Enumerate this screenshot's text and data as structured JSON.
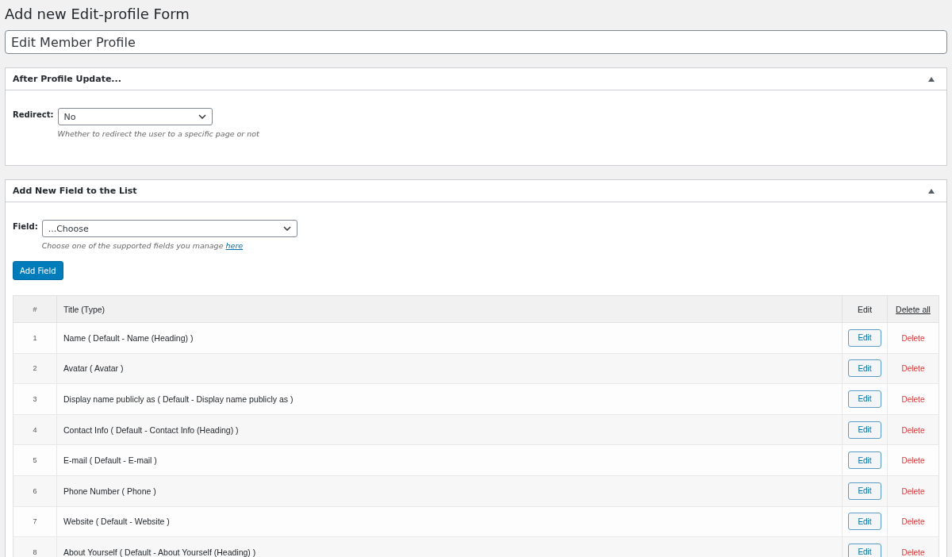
{
  "page_title": "Add new Edit-profile Form",
  "form_name": "Edit Member Profile",
  "after_update_panel": {
    "title": "After Profile Update...",
    "redirect_label": "Redirect:",
    "redirect_value": "No",
    "redirect_hint": "Whether to redirect the user to a specific page or not"
  },
  "add_field_panel": {
    "title": "Add New Field to the List",
    "field_label": "Field:",
    "field_value": "...Choose",
    "field_hint": "Choose one of the supported fields you manage",
    "hint_link": "here",
    "add_button": "Add Field"
  },
  "table": {
    "columns": [
      "#",
      "Title (Type)",
      "Edit",
      "Delete all"
    ],
    "rows": [
      {
        "num": "1",
        "title": "Name ( Default - Name (Heading) )",
        "edit": "Edit",
        "delete": "Delete"
      },
      {
        "num": "2",
        "title": "Avatar ( Avatar )",
        "edit": "Edit",
        "delete": "Delete"
      },
      {
        "num": "3",
        "title": "Display name publicly as ( Default - Display name publicly as )",
        "edit": "Edit",
        "delete": "Delete"
      },
      {
        "num": "4",
        "title": "Contact Info ( Default - Contact Info (Heading) )",
        "edit": "Edit",
        "delete": "Delete"
      },
      {
        "num": "5",
        "title": "E-mail ( Default - E-mail )",
        "edit": "Edit",
        "delete": "Delete"
      },
      {
        "num": "6",
        "title": "Phone Number ( Phone )",
        "edit": "Edit",
        "delete": "Delete"
      },
      {
        "num": "7",
        "title": "Website ( Default - Website )",
        "edit": "Edit",
        "delete": "Delete"
      },
      {
        "num": "8",
        "title": "About Yourself ( Default - About Yourself (Heading) )",
        "edit": "Edit",
        "delete": "Delete"
      }
    ]
  }
}
